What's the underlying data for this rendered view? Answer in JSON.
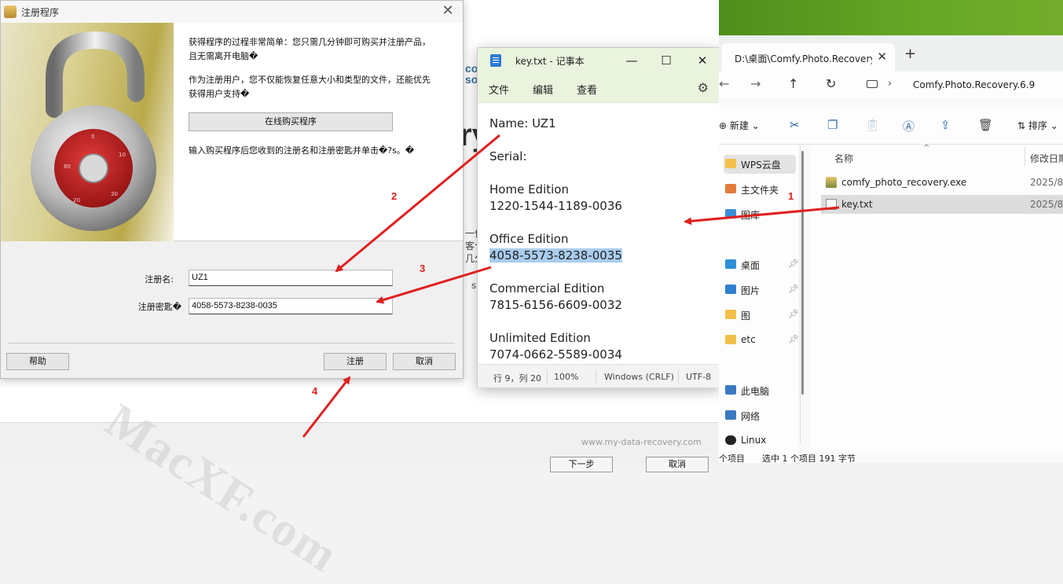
{
  "background_window": {
    "url_text": "www.my-data-recovery.com",
    "footer_btn_next": "下一步",
    "footer_btn_cancel": "取消",
    "partial_left_text": "co\nso",
    "partial_brand": "ry",
    "partial_side_lines": [
      "一件",
      "客个",
      "几分",
      "s"
    ]
  },
  "dialog": {
    "title": "注册程序",
    "text1_line1": "获得程序的过程非常简单：您只需几分钟即可购买并注册产品，",
    "text1_line2": "且无需离开电脑�",
    "text2_line1": "作为注册用户，您不仅能恢复任意大小和类型的文件，还能优先",
    "text2_line2": "获得用户支持�",
    "buy_online_button": "在线购买程序",
    "text3": "输入购买程序后您收到的注册名和注册密匙并单击�?s。�",
    "name_label": "注册名:",
    "name_value": "UZ1",
    "key_label": "注册密匙�",
    "key_value": "4058-5573-8238-0035",
    "help_button": "帮助",
    "register_button": "注册",
    "cancel_button": "取消"
  },
  "notepad": {
    "title": "key.txt - 记事本",
    "menu": [
      "文件",
      "编辑",
      "查看"
    ],
    "lines": [
      {
        "text": "Name: UZ1",
        "selected": false
      },
      {
        "text": "Serial:",
        "selected": false
      },
      {
        "text": "Home Edition",
        "selected": false
      },
      {
        "text": "1220-1544-1189-0036",
        "selected": false
      },
      {
        "text": "Office Edition",
        "selected": false
      },
      {
        "text": "4058-5573-8238-0035",
        "selected": true
      },
      {
        "text": "Commercial Edition",
        "selected": false
      },
      {
        "text": "7815-6156-6609-0032",
        "selected": false
      },
      {
        "text": "Unlimited Edition",
        "selected": false
      },
      {
        "text": "7074-0662-5589-0034",
        "selected": false
      }
    ],
    "status": {
      "position": "行 9，列 20",
      "zoom": "100%",
      "eol": "Windows (CRLF)",
      "encoding": "UTF-8"
    }
  },
  "explorer": {
    "tab_label": "D:\\桌面\\Comfy.Photo.Recovery",
    "address_path": "Comfy.Photo.Recovery.6.9",
    "new_label": "新建",
    "sort_label": "排序",
    "columns": {
      "name": "名称",
      "modified": "修改日期"
    },
    "nav_items": [
      {
        "label": "WPS云盘",
        "icon": "cloud-folder-icon",
        "pinned": false
      },
      {
        "label": "主文件夹",
        "icon": "home-icon",
        "pinned": false
      },
      {
        "label": "图库",
        "icon": "gallery-icon",
        "pinned": false
      },
      {
        "label": "桌面",
        "icon": "desktop-icon",
        "pinned": true
      },
      {
        "label": "图片",
        "icon": "pictures-icon",
        "pinned": true
      },
      {
        "label": "图",
        "icon": "folder-icon",
        "pinned": true
      },
      {
        "label": "etc",
        "icon": "folder-icon",
        "pinned": true
      },
      {
        "label": "此电脑",
        "icon": "computer-icon",
        "pinned": false
      },
      {
        "label": "网络",
        "icon": "network-icon",
        "pinned": false
      },
      {
        "label": "Linux",
        "icon": "linux-icon",
        "pinned": false
      }
    ],
    "files": [
      {
        "name": "comfy_photo_recovery.exe",
        "date": "2025/8/",
        "selected": false
      },
      {
        "name": "key.txt",
        "date": "2025/8/",
        "selected": true
      }
    ],
    "status_items": "个项目",
    "status_selected": "选中 1 个项目  191 字节"
  },
  "annotations": {
    "steps": [
      "1",
      "2",
      "3",
      "4"
    ],
    "arrow_color": "#e02020",
    "watermark": "MacXF.com"
  }
}
